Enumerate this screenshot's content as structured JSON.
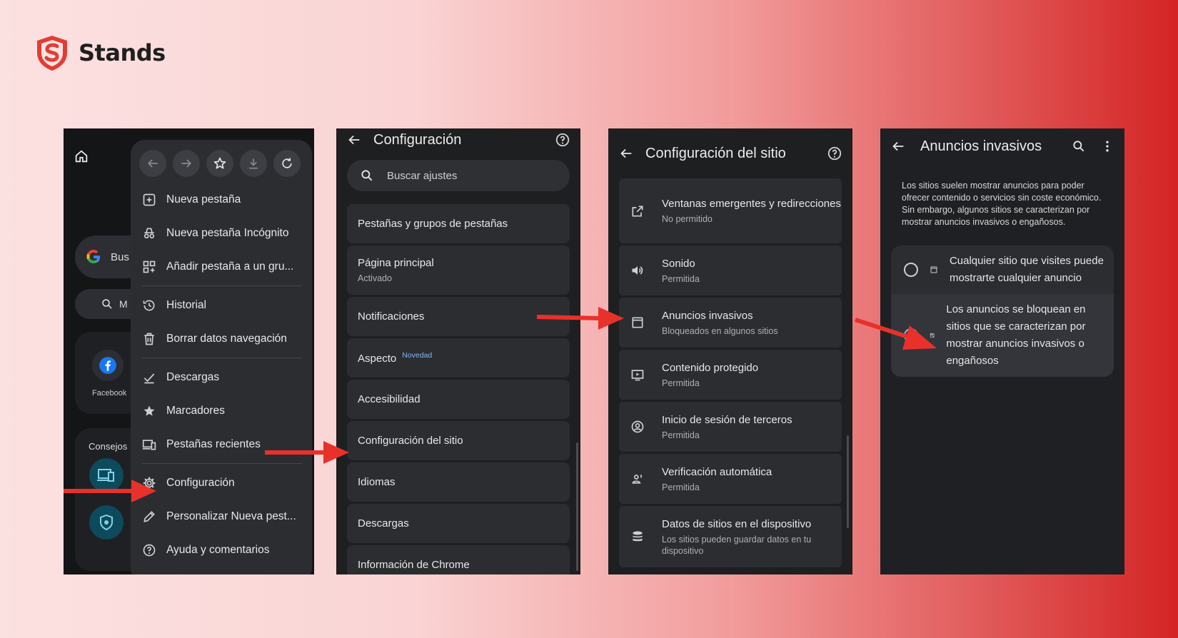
{
  "brand": {
    "name": "Stands",
    "color": "#e23d32"
  },
  "panel1": {
    "search_stub": "Bus",
    "lens_stub": "M",
    "shortcut_label": "Facebook",
    "tips_label": "Consejos",
    "menu_items": [
      {
        "label": "Nueva pestaña",
        "icon": "plus-box-icon"
      },
      {
        "label": "Nueva pestaña Incógnito",
        "icon": "incognito-icon"
      },
      {
        "label": "Añadir pestaña a un gru...",
        "icon": "tab-group-icon"
      },
      {
        "label": "Historial",
        "icon": "history-icon"
      },
      {
        "label": "Borrar datos navegación",
        "icon": "trash-icon"
      },
      {
        "label": "Descargas",
        "icon": "download-check-icon"
      },
      {
        "label": "Marcadores",
        "icon": "star-icon"
      },
      {
        "label": "Pestañas recientes",
        "icon": "devices-icon"
      },
      {
        "label": "Configuración",
        "icon": "gear-icon"
      },
      {
        "label": "Personalizar Nueva pest...",
        "icon": "pencil-icon"
      },
      {
        "label": "Ayuda y comentarios",
        "icon": "help-icon"
      }
    ]
  },
  "panel2": {
    "title": "Configuración",
    "search_placeholder": "Buscar ajustes",
    "items": [
      {
        "title": "Pestañas y grupos de pestañas"
      },
      {
        "title": "Página principal",
        "subtitle": "Activado"
      },
      {
        "title": "Notificaciones"
      },
      {
        "title": "Aspecto",
        "badge": "Novedad"
      },
      {
        "title": "Accesibilidad"
      },
      {
        "title": "Configuración del sitio"
      },
      {
        "title": "Idiomas"
      },
      {
        "title": "Descargas"
      },
      {
        "title": "Información de Chrome"
      }
    ]
  },
  "panel3": {
    "title": "Configuración del sitio",
    "items": [
      {
        "title": "Ventanas emergentes y redirecciones",
        "subtitle": "No permitido",
        "icon": "open-external-icon"
      },
      {
        "title": "Sonido",
        "subtitle": "Permitida",
        "icon": "speaker-icon"
      },
      {
        "title": "Anuncios invasivos",
        "subtitle": "Bloqueados en algunos sitios",
        "icon": "ad-box-icon"
      },
      {
        "title": "Contenido protegido",
        "subtitle": "Permitida",
        "icon": "protected-media-icon"
      },
      {
        "title": "Inicio de sesión de terceros",
        "subtitle": "Permitida",
        "icon": "account-circle-icon"
      },
      {
        "title": "Verificación automática",
        "subtitle": "Permitida",
        "icon": "person-verify-icon"
      },
      {
        "title": "Datos de sitios en el dispositivo",
        "subtitle": "Los sitios pueden guardar datos en tu dispositivo",
        "icon": "database-icon"
      }
    ]
  },
  "panel4": {
    "title": "Anuncios invasivos",
    "description": "Los sitios suelen mostrar anuncios para poder ofrecer contenido o servicios sin coste económico. Sin embargo, algunos sitios se caracterizan por mostrar anuncios invasivos o engañosos.",
    "options": [
      {
        "label": "Cualquier sitio que visites puede mostrarte cualquier anuncio",
        "selected": false
      },
      {
        "label": "Los anuncios se bloquean en sitios que se caracterizan por mostrar anuncios invasivos o engañosos",
        "selected": true
      }
    ]
  },
  "colors": {
    "arrow": "#e8312a",
    "accent": "#8ab4f8",
    "panel_bg": "#1e1f21"
  }
}
